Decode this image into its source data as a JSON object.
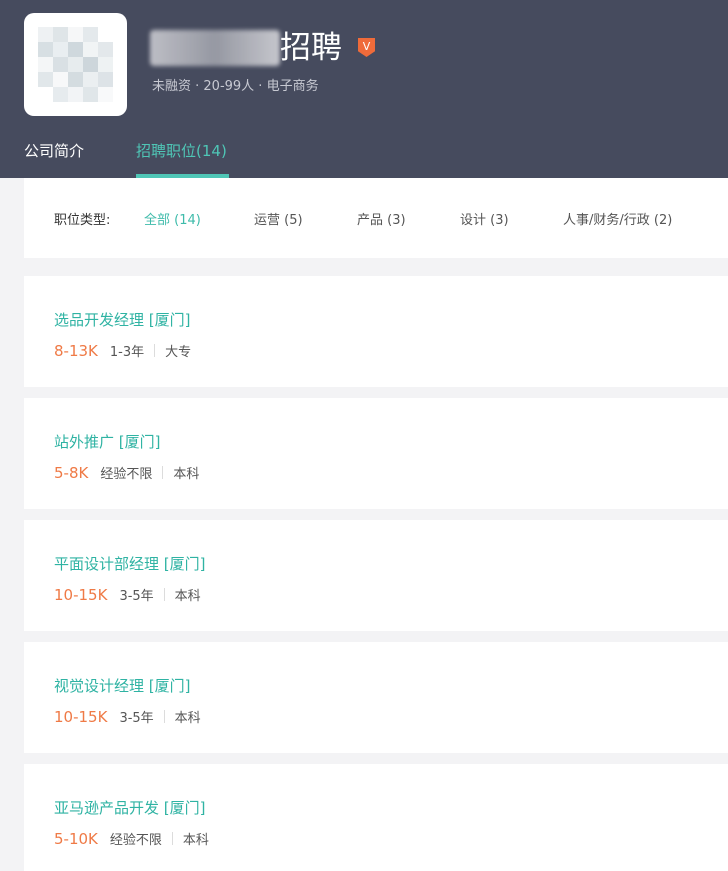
{
  "company": {
    "name": "招聘",
    "meta": "未融资 · 20-99人 · 电子商务",
    "verified_badge": "V"
  },
  "tabs": [
    {
      "label": "公司简介"
    },
    {
      "label": "招聘职位(14)"
    }
  ],
  "filter": {
    "label": "职位类型:",
    "options": [
      "全部 (14)",
      "运营 (5)",
      "产品 (3)",
      "设计 (3)",
      "人事/财务/行政 (2)"
    ]
  },
  "jobs": [
    {
      "title": "选品开发经理  [厦门]",
      "salary": "8-13K",
      "experience": "1-3年",
      "education": "大专"
    },
    {
      "title": "站外推广  [厦门]",
      "salary": "5-8K",
      "experience": "经验不限",
      "education": "本科"
    },
    {
      "title": "平面设计部经理  [厦门]",
      "salary": "10-15K",
      "experience": "3-5年",
      "education": "本科"
    },
    {
      "title": "视觉设计经理  [厦门]",
      "salary": "10-15K",
      "experience": "3-5年",
      "education": "本科"
    },
    {
      "title": "亚马逊产品开发  [厦门]",
      "salary": "5-10K",
      "experience": "经验不限",
      "education": "本科"
    }
  ],
  "colors": {
    "header_bg": "#464b5e",
    "accent_teal": "#2fb3a3",
    "salary_orange": "#ef7a46",
    "badge_orange": "#ef6b3a"
  }
}
